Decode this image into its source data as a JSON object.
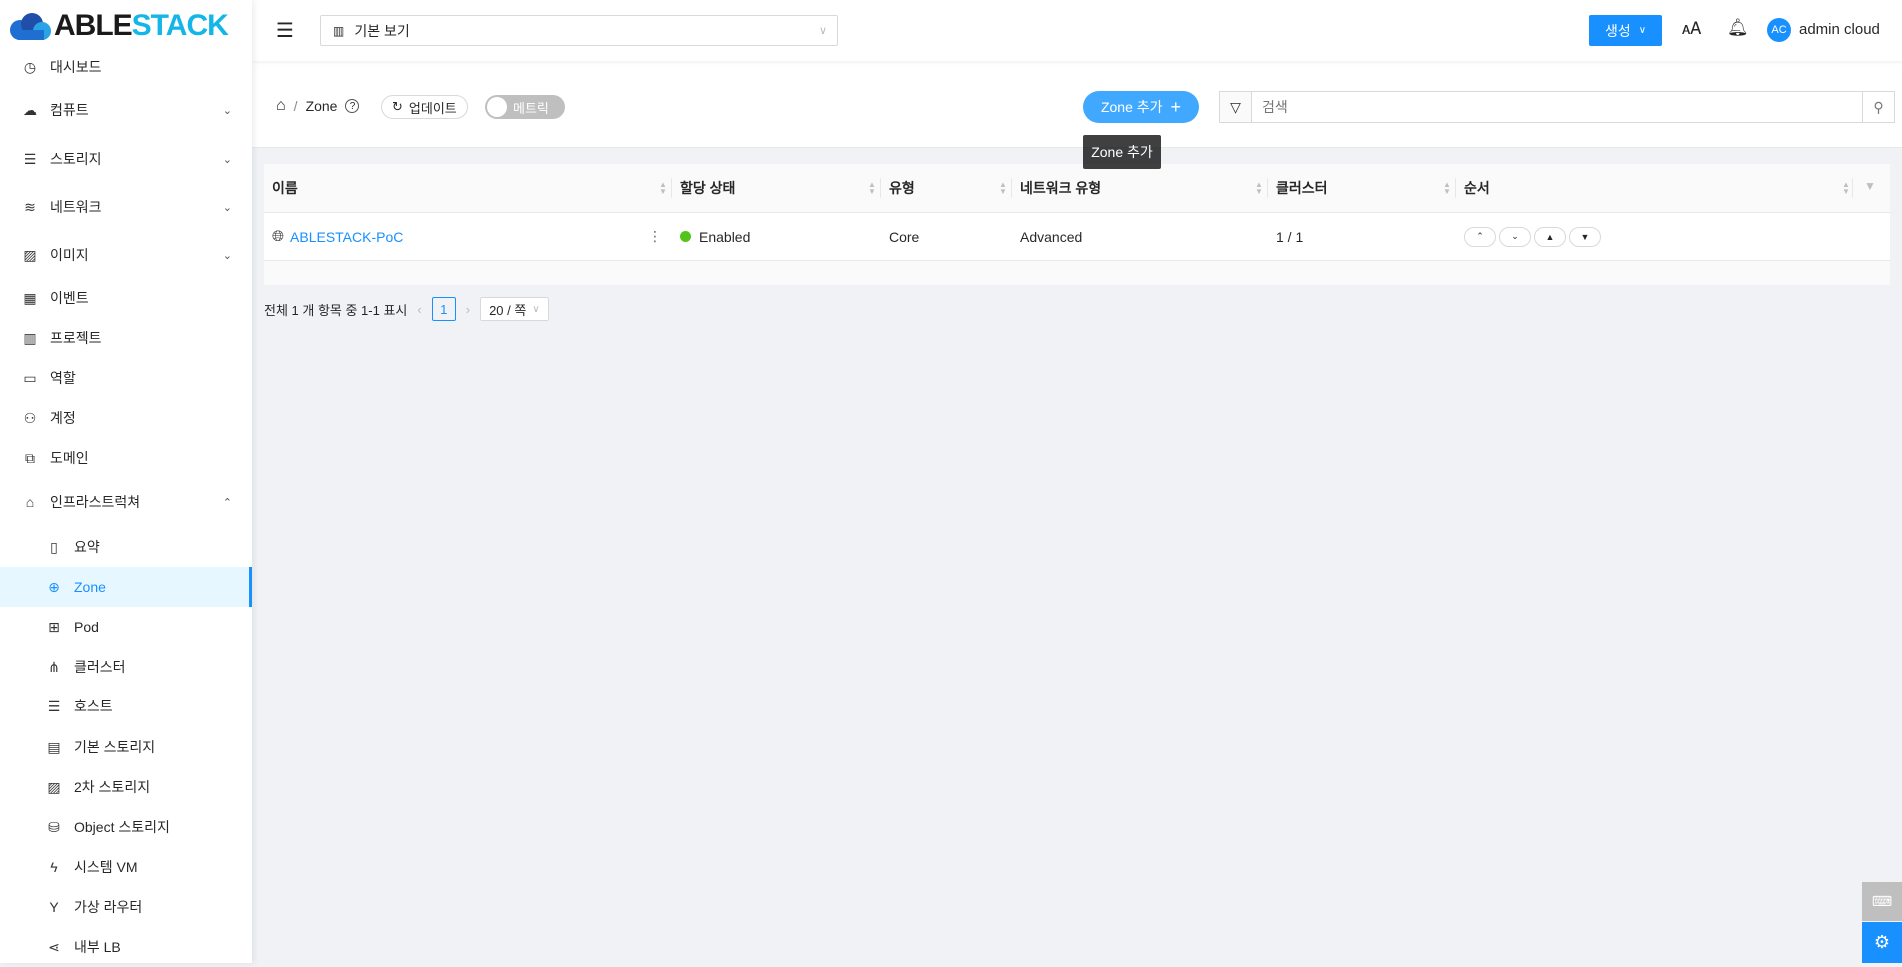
{
  "logo": {
    "text_dark": "ABLE",
    "text_accent": "STACK"
  },
  "sidebar": {
    "items": [
      {
        "label": "대시보드",
        "icon": "dashboard-icon"
      },
      {
        "label": "컴퓨트",
        "icon": "cloud-icon"
      },
      {
        "label": "스토리지",
        "icon": "database-icon"
      },
      {
        "label": "네트워크",
        "icon": "wifi-icon"
      },
      {
        "label": "이미지",
        "icon": "picture-icon"
      },
      {
        "label": "이벤트",
        "icon": "schedule-icon"
      },
      {
        "label": "프로젝트",
        "icon": "project-icon"
      },
      {
        "label": "역할",
        "icon": "idcard-icon"
      },
      {
        "label": "계정",
        "icon": "team-icon"
      },
      {
        "label": "도메인",
        "icon": "block-icon"
      },
      {
        "label": "인프라스트럭쳐",
        "icon": "bank-icon"
      }
    ],
    "sub_items": [
      {
        "label": "요약",
        "icon": "read-icon"
      },
      {
        "label": "Zone",
        "icon": "global-icon"
      },
      {
        "label": "Pod",
        "icon": "appstore-icon"
      },
      {
        "label": "클러스터",
        "icon": "cluster-icon"
      },
      {
        "label": "호스트",
        "icon": "database-icon"
      },
      {
        "label": "기본 스토리지",
        "icon": "hdd-icon"
      },
      {
        "label": "2차 스토리지",
        "icon": "picture-icon"
      },
      {
        "label": "Object 스토리지",
        "icon": "gold-icon"
      },
      {
        "label": "시스템 VM",
        "icon": "thunderbolt-icon"
      },
      {
        "label": "가상 라우터",
        "icon": "fork-icon"
      },
      {
        "label": "내부 LB",
        "icon": "share-icon"
      }
    ]
  },
  "header": {
    "view_select": "기본 보기",
    "create_label": "생성",
    "user_initials": "AC",
    "user_name": "admin cloud"
  },
  "toolbar": {
    "breadcrumb_page": "Zone",
    "refresh_label": "업데이트",
    "metrics_label": "메트릭",
    "add_zone_label": "Zone 추가",
    "tooltip": "Zone 추가",
    "search_placeholder": "검색"
  },
  "table": {
    "columns": [
      "이름",
      "할당 상태",
      "유형",
      "네트워크 유형",
      "클러스터",
      "순서"
    ],
    "rows": [
      {
        "name": "ABLESTACK-PoC",
        "state": "Enabled",
        "type": "Core",
        "network_type": "Advanced",
        "clusters": "1 / 1"
      }
    ]
  },
  "pagination": {
    "summary": "전체 1 개 항목 중 1-1 표시",
    "current_page": "1",
    "page_size": "20 / 쪽"
  },
  "colors": {
    "accent": "#1890ff",
    "enabled": "#52c41a"
  }
}
